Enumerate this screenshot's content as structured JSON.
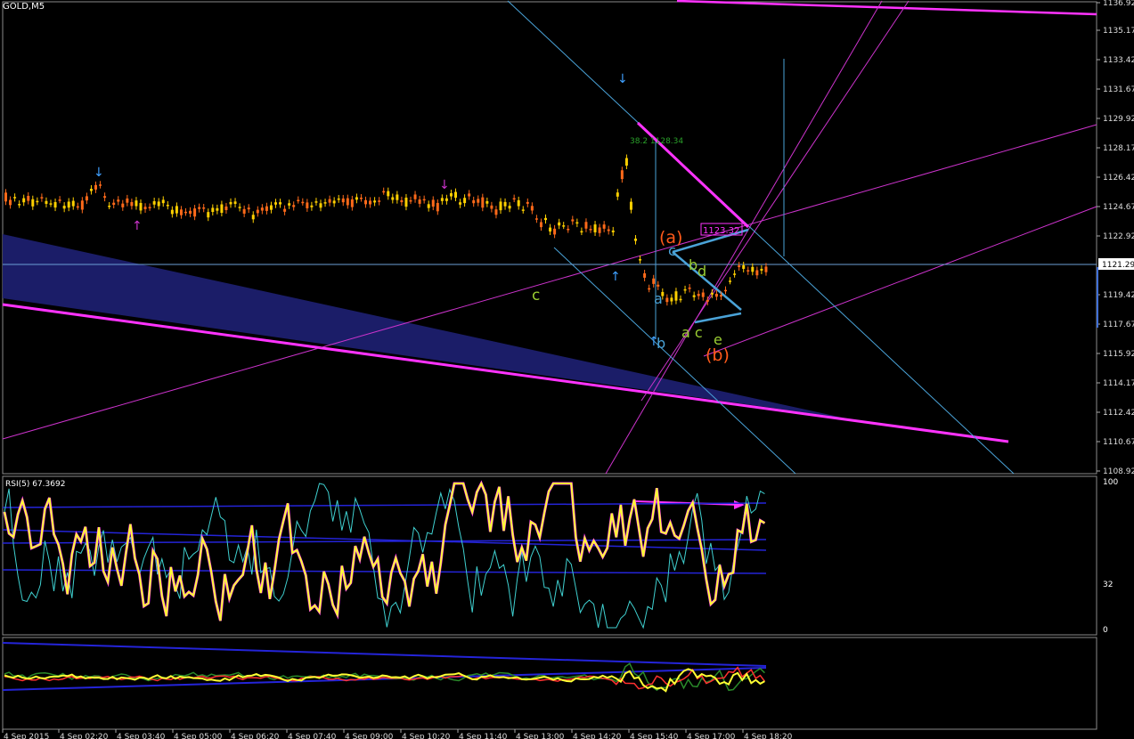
{
  "symbol_title": "GOLD,M5",
  "price_axis": {
    "ticks": [
      "1136.92",
      "1135.17",
      "1133.42",
      "1131.67",
      "1129.92",
      "1128.17",
      "1126.42",
      "1124.67",
      "1122.92",
      "1119.42",
      "1117.67",
      "1115.92",
      "1114.17",
      "1112.42",
      "1110.67",
      "1108.92"
    ],
    "current_price": "1121.29"
  },
  "rsi": {
    "title": "RSI(5) 67.3692",
    "ticks": [
      "100",
      "32",
      "0"
    ]
  },
  "time_axis": [
    "4 Sep 2015",
    "4 Sep 02:20",
    "4 Sep 03:40",
    "4 Sep 05:00",
    "4 Sep 06:20",
    "4 Sep 07:40",
    "4 Sep 09:00",
    "4 Sep 10:20",
    "4 Sep 11:40",
    "4 Sep 13:00",
    "4 Sep 14:20",
    "4 Sep 15:40",
    "4 Sep 17:00",
    "4 Sep 18:20"
  ],
  "annotations": {
    "price_box": "1123.32",
    "fib_label": "38.2  1128.34",
    "wave_a_paren": "(a)",
    "wave_b_paren": "(b)",
    "wave_c_left": "c",
    "wave_a": "a",
    "wave_b": "b",
    "wave_c": "c",
    "wave_b2": "b",
    "wave_d": "d",
    "wave_ac": "a c",
    "wave_e": "e"
  },
  "colors": {
    "background": "#000000",
    "bull_candle": "#ffd000",
    "bear_candle": "#ff6a1a",
    "magenta": "#ff33ff",
    "cyan_line": "#4aa3d8",
    "rsi_line": "#ffff33",
    "navy_channel": "#1c1f6e"
  }
}
